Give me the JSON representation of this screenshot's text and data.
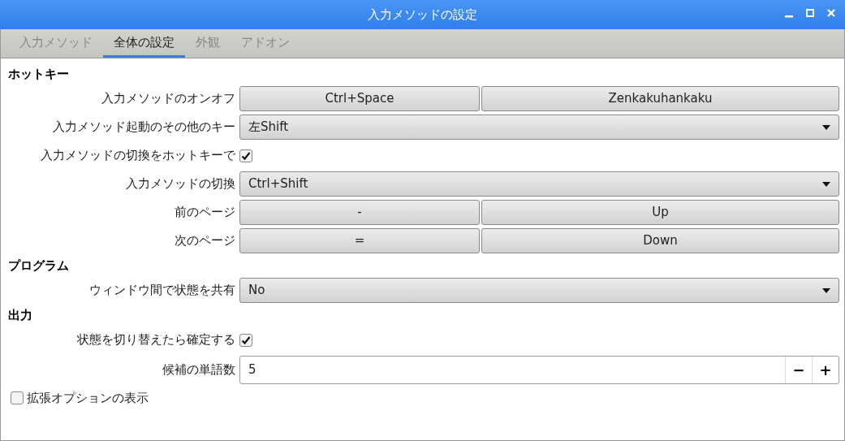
{
  "window": {
    "title": "入力メソッドの設定"
  },
  "tabs": [
    {
      "label": "入力メソッド",
      "selected": false
    },
    {
      "label": "全体の設定",
      "selected": true
    },
    {
      "label": "外観",
      "selected": false
    },
    {
      "label": "アドオン",
      "selected": false
    }
  ],
  "sections": [
    {
      "title": "ホットキー",
      "rows": [
        {
          "kind": "keys",
          "label": "入力メソッドのオンオフ",
          "keys": [
            "Ctrl+Space",
            "Zenkakuhankaku"
          ]
        },
        {
          "kind": "dropdown",
          "label": "入力メソッド起動のその他のキー",
          "value": "左Shift"
        },
        {
          "kind": "checkbox",
          "label": "入力メソッドの切換をホットキーで",
          "checked": true
        },
        {
          "kind": "dropdown",
          "label": "入力メソッドの切換",
          "value": "Ctrl+Shift"
        },
        {
          "kind": "keys",
          "label": "前のページ",
          "keys": [
            "-",
            "Up"
          ]
        },
        {
          "kind": "keys",
          "label": "次のページ",
          "keys": [
            "=",
            "Down"
          ]
        }
      ]
    },
    {
      "title": "プログラム",
      "rows": [
        {
          "kind": "dropdown",
          "label": "ウィンドウ間で状態を共有",
          "value": "No"
        }
      ]
    },
    {
      "title": "出力",
      "rows": [
        {
          "kind": "checkbox",
          "label": "状態を切り替えたら確定する",
          "checked": true
        },
        {
          "kind": "spin",
          "label": "候補の単語数",
          "value": "5",
          "decrement": "−",
          "increment": "+"
        }
      ]
    }
  ],
  "advanced": {
    "label": "拡張オプションの表示",
    "checked": false
  }
}
